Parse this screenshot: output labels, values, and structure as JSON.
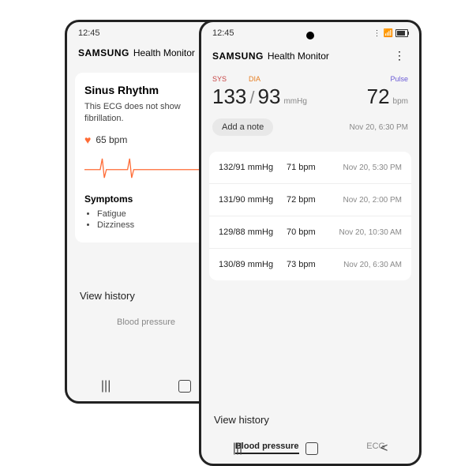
{
  "status": {
    "time": "12:45"
  },
  "brand": "SAMSUNG",
  "brand_sub": "Health Monitor",
  "back_phone": {
    "sinus_title": "Sinus Rhythm",
    "sinus_desc": "This ECG does not show fibrillation.",
    "bpm": "65 bpm",
    "symptoms_title": "Symptoms",
    "symptoms": [
      "Fatigue",
      "Dizziness"
    ],
    "view_history": "View history",
    "tab": "Blood pressure"
  },
  "front_phone": {
    "labels": {
      "sys": "SYS",
      "dia": "DIA",
      "pulse": "Pulse"
    },
    "sys": "133",
    "dia": "93",
    "unit": "mmHg",
    "pulse": "72",
    "pulse_unit": "bpm",
    "add_note": "Add a note",
    "current_time": "Nov 20, 6:30 PM",
    "history": [
      {
        "bp": "132/91 mmHg",
        "bpm": "71 bpm",
        "time": "Nov 20, 5:30 PM"
      },
      {
        "bp": "131/90 mmHg",
        "bpm": "72 bpm",
        "time": "Nov 20, 2:00 PM"
      },
      {
        "bp": "129/88 mmHg",
        "bpm": "70 bpm",
        "time": "Nov 20, 10:30 AM"
      },
      {
        "bp": "130/89 mmHg",
        "bpm": "73 bpm",
        "time": "Nov 20, 6:30 AM"
      }
    ],
    "view_history": "View history",
    "tabs": {
      "bp": "Blood pressure",
      "ecg": "ECG"
    }
  }
}
